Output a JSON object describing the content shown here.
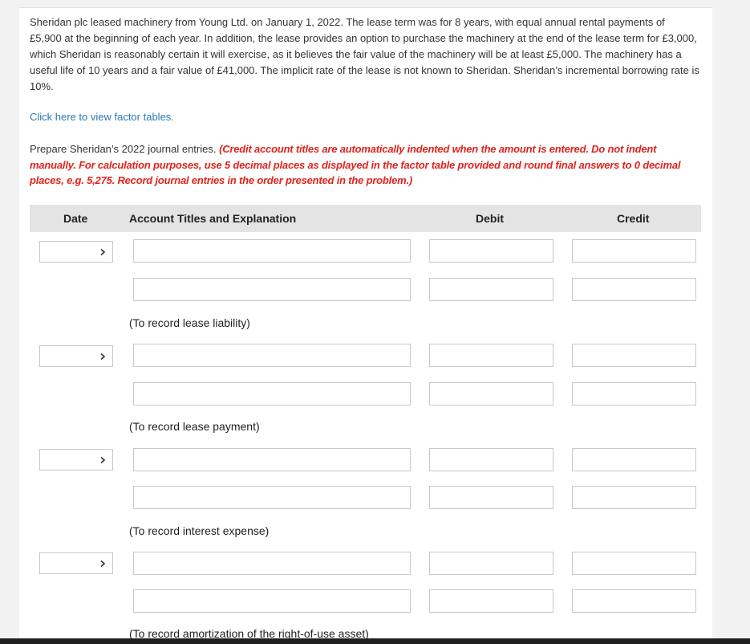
{
  "problem_text": "Sheridan plc leased machinery from Young Ltd. on January 1, 2022. The lease term was for 8 years, with equal annual rental payments of £5,900 at the beginning of each year. In addition, the lease provides an option to purchase the machinery at the end of the lease term for £3,000, which Sheridan is reasonably certain it will exercise, as it believes the fair value of the machinery will be at least £5,000. The machinery has a useful life of 10 years and a fair value of £41,000. The implicit rate of the lease is not known to Sheridan. Sheridan’s incremental borrowing rate is 10%.",
  "factor_link": "Click here to view factor tables.",
  "instruction_lead": "Prepare Sheridan’s 2022 journal entries.",
  "instruction_red": "(Credit account titles are automatically indented when the amount is entered. Do not indent manually. For calculation purposes, use 5 decimal places as displayed in the factor table provided and round final answers to 0 decimal places, e.g. 5,275. Record journal entries in the order presented in the problem.)",
  "table": {
    "col_date": "Date",
    "col_account": "Account Titles and Explanation",
    "col_debit": "Debit",
    "col_credit": "Credit"
  },
  "entries": [
    {
      "date_value": "",
      "rows": [
        {
          "account": "",
          "debit": "",
          "credit": ""
        },
        {
          "account": "",
          "debit": "",
          "credit": ""
        }
      ],
      "note": "(To record lease liability)"
    },
    {
      "date_value": "",
      "rows": [
        {
          "account": "",
          "debit": "",
          "credit": ""
        },
        {
          "account": "",
          "debit": "",
          "credit": ""
        }
      ],
      "note": "(To record lease payment)"
    },
    {
      "date_value": "",
      "rows": [
        {
          "account": "",
          "debit": "",
          "credit": ""
        },
        {
          "account": "",
          "debit": "",
          "credit": ""
        }
      ],
      "note": "(To record interest expense)"
    },
    {
      "date_value": "",
      "rows": [
        {
          "account": "",
          "debit": "",
          "credit": ""
        },
        {
          "account": "",
          "debit": "",
          "credit": ""
        }
      ],
      "note": "(To record amortization of the right-of-use asset)"
    }
  ],
  "icons": {
    "date_dropdown": "chevron-down-icon"
  }
}
